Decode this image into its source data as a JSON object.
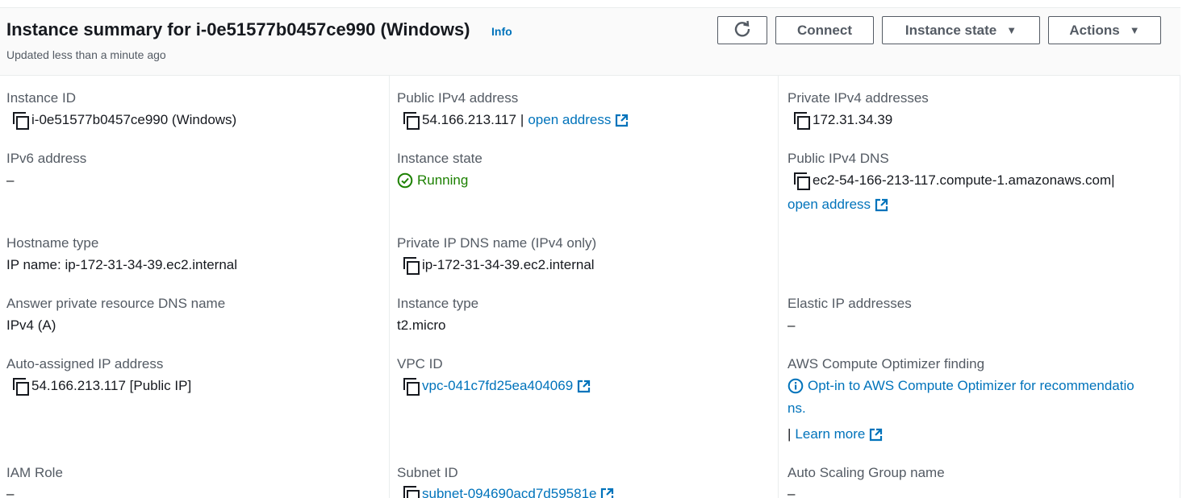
{
  "header": {
    "title": "Instance summary for i-0e51577b0457ce990 (Windows)",
    "info": "Info",
    "subtitle": "Updated less than a minute ago",
    "buttons": {
      "connect": "Connect",
      "instance_state": "Instance state",
      "actions": "Actions"
    }
  },
  "fields": {
    "instance_id": {
      "label": "Instance ID",
      "value": "i-0e51577b0457ce990 (Windows)"
    },
    "public_ipv4": {
      "label": "Public IPv4 address",
      "value": "54.166.213.117",
      "link": "open address"
    },
    "private_ipv4": {
      "label": "Private IPv4 addresses",
      "value": "172.31.34.39"
    },
    "ipv6": {
      "label": "IPv6 address",
      "value": "–"
    },
    "instance_state": {
      "label": "Instance state",
      "value": "Running"
    },
    "public_dns": {
      "label": "Public IPv4 DNS",
      "value": "ec2-54-166-213-117.compute-1.amazonaws.com",
      "link": "open address"
    },
    "hostname_type": {
      "label": "Hostname type",
      "value": "IP name: ip-172-31-34-39.ec2.internal"
    },
    "private_dns": {
      "label": "Private IP DNS name (IPv4 only)",
      "value": "ip-172-31-34-39.ec2.internal"
    },
    "answer_dns": {
      "label": "Answer private resource DNS name",
      "value": "IPv4 (A)"
    },
    "instance_type": {
      "label": "Instance type",
      "value": "t2.micro"
    },
    "elastic_ip": {
      "label": "Elastic IP addresses",
      "value": "–"
    },
    "auto_ip": {
      "label": "Auto-assigned IP address",
      "value": "54.166.213.117 [Public IP]"
    },
    "vpc_id": {
      "label": "VPC ID",
      "value": "vpc-041c7fd25ea404069"
    },
    "optimizer": {
      "label": "AWS Compute Optimizer finding",
      "line1": "Opt-in to AWS Compute Optimizer for recommendatio",
      "line2": "ns.",
      "learn_more": "Learn more"
    },
    "iam_role": {
      "label": "IAM Role",
      "value": "–"
    },
    "subnet_id": {
      "label": "Subnet ID",
      "value": "subnet-094690acd7d59581e"
    },
    "asg_name": {
      "label": "Auto Scaling Group name",
      "value": "–"
    }
  },
  "colors": {
    "link": "#0073bb",
    "running": "#1d8102",
    "text": "#16191f",
    "muted": "#545b64"
  }
}
